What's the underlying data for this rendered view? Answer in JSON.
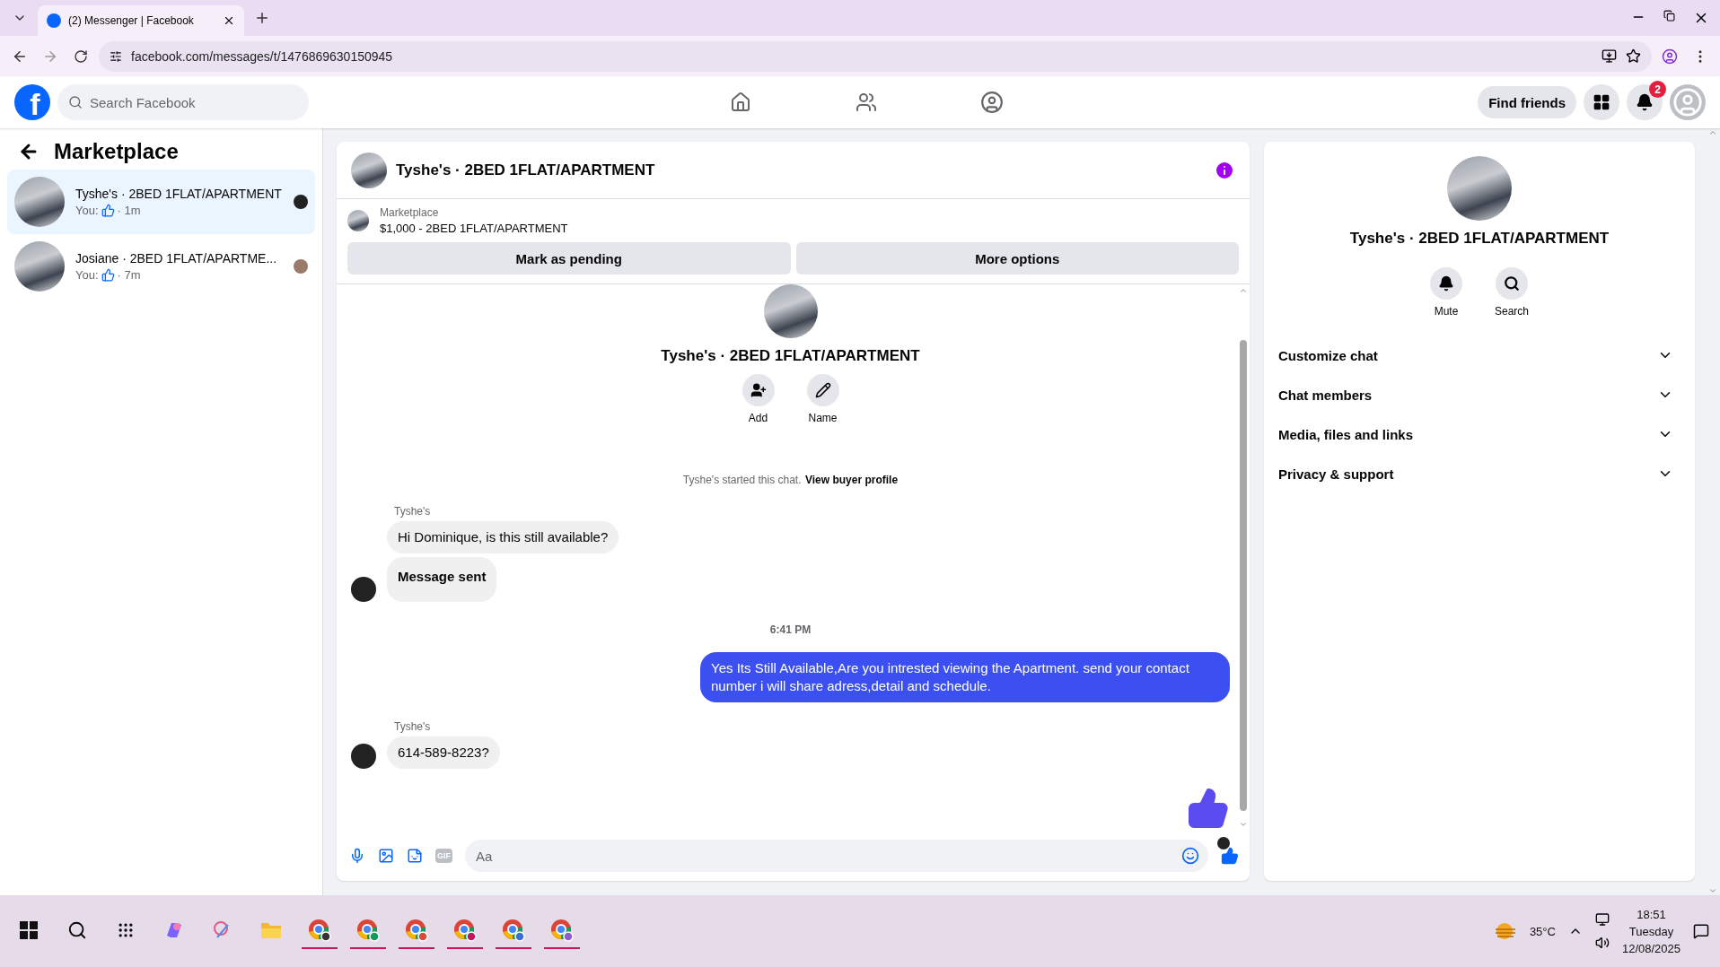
{
  "browser": {
    "tab_title": "(2) Messenger | Facebook",
    "url": "facebook.com/messages/t/1476869630150945"
  },
  "header": {
    "logo_letter": "f",
    "search_placeholder": "Search Facebook",
    "find_friends": "Find friends",
    "notification_count": "2"
  },
  "sidebar": {
    "title": "Marketplace",
    "conversations": [
      {
        "title": "Tyshe's · 2BED 1FLAT/APARTMENT",
        "preview": "You:",
        "time": "· 1m",
        "selected": true
      },
      {
        "title": "Josiane · 2BED 1FLAT/APARTME...",
        "preview": "You:",
        "time": "· 7m",
        "selected": false
      }
    ]
  },
  "chat": {
    "title": "Tyshe's · 2BED 1FLAT/APARTMENT",
    "listing": {
      "label": "Marketplace",
      "name": "$1,000 - 2BED 1FLAT/APARTMENT"
    },
    "actions": [
      "Mark as pending",
      "More options"
    ],
    "intro": {
      "title": "Tyshe's · 2BED 1FLAT/APARTMENT",
      "buttons": [
        {
          "kind": "add",
          "label": "Add"
        },
        {
          "kind": "name",
          "label": "Name"
        }
      ]
    },
    "started": {
      "text": "Tyshe's started this chat.",
      "link": "View buyer profile"
    },
    "messages": [
      {
        "kind": "sender",
        "text": "Tyshe's"
      },
      {
        "kind": "incoming",
        "text": "Hi Dominique, is this still available?",
        "bold": false,
        "avatar": false
      },
      {
        "kind": "incoming",
        "text": "Message sent",
        "bold": true,
        "avatar": true
      },
      {
        "kind": "time",
        "text": "6:41 PM"
      },
      {
        "kind": "outgoing",
        "text": "Yes Its Still Available,Are you intrested viewing the Apartment. send your contact number i will share adress,detail and schedule."
      },
      {
        "kind": "sender",
        "text": "Tyshe's"
      },
      {
        "kind": "incoming",
        "text": "614-589-8223?",
        "bold": false,
        "avatar": true
      },
      {
        "kind": "like"
      }
    ],
    "composer": {
      "gif_label": "GIF",
      "placeholder": "Aa"
    }
  },
  "details": {
    "title": "Tyshe's · 2BED 1FLAT/APARTMENT",
    "actions": [
      {
        "kind": "mute",
        "label": "Mute"
      },
      {
        "kind": "search",
        "label": "Search"
      }
    ],
    "sections": [
      {
        "label": "Customize chat",
        "expanded": false
      },
      {
        "label": "Chat members",
        "expanded": false
      },
      {
        "label": "Media, files and links",
        "expanded": false
      },
      {
        "label": "Privacy & support",
        "expanded": false
      }
    ]
  },
  "taskbar": {
    "temperature": "35°C",
    "time": "18:51",
    "day": "Tuesday",
    "date": "12/08/2025"
  }
}
